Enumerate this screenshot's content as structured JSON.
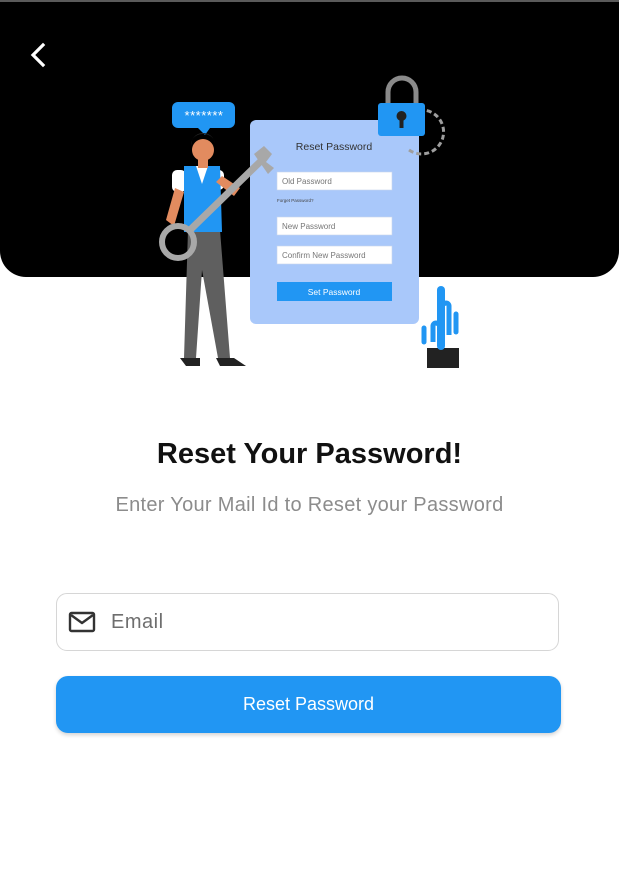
{
  "header": {
    "back_icon": "chevron-left-icon",
    "background": "#000000"
  },
  "illustration": {
    "bubble_text": "*******",
    "card_title": "Reset Password",
    "old_password_placeholder": "Old Password",
    "forgot_link": "Forget Password?",
    "new_password_placeholder": "New Password",
    "confirm_password_placeholder": "Confirm New Password",
    "set_button_label": "Set Password",
    "lock_icon": "padlock-icon",
    "key_icon": "key-icon",
    "plant_icon": "cactus-icon"
  },
  "main": {
    "title": "Reset Your Password!",
    "subtitle": "Enter Your Mail Id to Reset your Password"
  },
  "form": {
    "email_icon": "mail-icon",
    "email_placeholder": "Email",
    "email_value": "",
    "submit_label": "Reset Password"
  },
  "colors": {
    "accent": "#2196f3",
    "card": "#a9c8fa",
    "text_primary": "#111111",
    "text_secondary": "#8c8c8c"
  }
}
